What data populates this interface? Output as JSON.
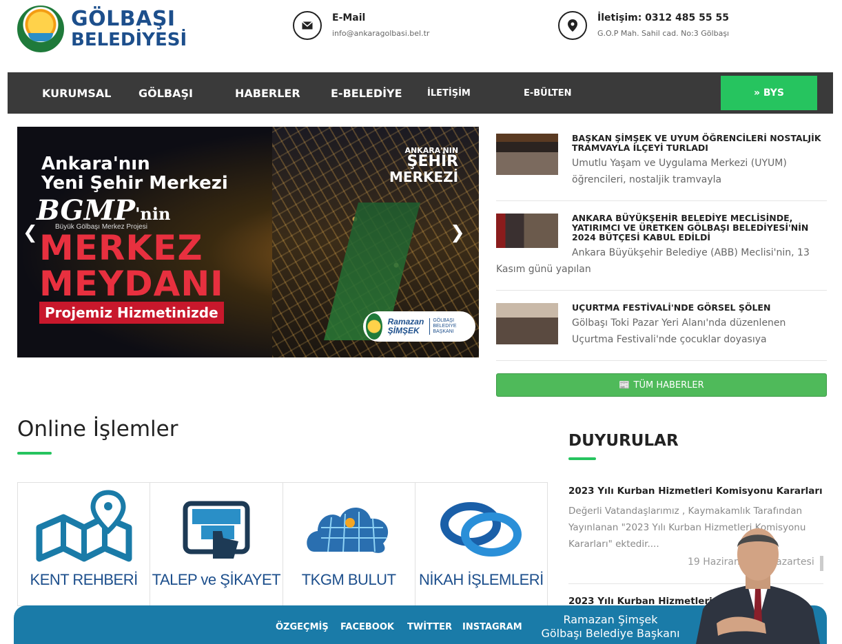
{
  "header": {
    "logo": {
      "line1": "GÖLBAŞI",
      "line2": "BELEDİYESİ",
      "seal_text": "GÖLBAŞI BELEDİYESİ 1965"
    },
    "email": {
      "icon": "envelope-icon",
      "title": "E-Mail",
      "value": "info@ankaragolbasi.bel.tr"
    },
    "phone": {
      "icon": "map-pin-icon",
      "title": "İletişim: 0312 485 55 55",
      "value": "G.O.P Mah. Sahil cad. No:3 Gölbaşı"
    }
  },
  "nav": {
    "items": [
      "KURUMSAL",
      "GÖLBAŞI",
      "HABERLER",
      "E-BELEDİYE",
      "İLETİŞİM",
      "E-BÜLTEN"
    ],
    "bys": "» BYS"
  },
  "slider": {
    "line1": "Ankara'nın",
    "line2": "Yeni Şehir Merkezi",
    "bgmp": "BGMP",
    "bgmp_suffix": "'nin",
    "bgmp_sub": "Büyük Gölbaşı Merkez Projesi",
    "merkez": "MERKEZ",
    "meydani": "MEYDANI",
    "projemiz": "Projemiz Hizmetinizde",
    "sehir_1": "ANKARA'NIN",
    "sehir_2": "ŞEHİR",
    "sehir_3": "MERKEZİ",
    "badge_name_1": "Ramazan",
    "badge_name_2": "ŞİMŞEK",
    "badge_title": "GÖLBAŞI BELEDİYE BAŞKANI"
  },
  "news": [
    {
      "title": "BAŞKAN ŞİMŞEK VE UYUM ÖĞRENCİLERİ NOSTALJİK TRAMVAYLA İLÇEYİ TURLADI",
      "desc_1": "Umutlu Yaşam ve Uygulama Merkezi (UYUM)",
      "desc_2": "öğrencileri, nostaljik tramvayla"
    },
    {
      "title": "ANKARA BÜYÜKŞEHİR BELEDİYE MECLİSİNDE, YATIRIMCI VE ÜRETKEN GÖLBAŞI BELEDİYESİ'NİN 2024 BÜTÇESİ KABUL EDİLDİ",
      "desc_1": "Ankara Büyükşehir Belediye (ABB) Meclisi'nin, 13",
      "desc_2": "Kasım günü yapılan"
    },
    {
      "title": "UÇURTMA FESTİVALİ'NDE GÖRSEL ŞÖLEN",
      "desc_1": "Gölbaşı Toki Pazar Yeri Alanı'nda düzenlenen",
      "desc_2": "Uçurtma Festivali'nde çocuklar doyasıya"
    }
  ],
  "all_news": "TÜM HABERLER",
  "online": {
    "title": "Online İşlemler",
    "tiles": [
      "KENT REHBERİ",
      "TALEP ve ŞİKAYET",
      "TKGM BULUT",
      "NİKAH İŞLEMLERİ"
    ]
  },
  "duyurular": {
    "title": "DUYURULAR",
    "item1_title": "2023 Yılı Kurban Hizmetleri Komisyonu Kararları",
    "item1_text": "Değerli Vatandaşlarımız , Kaymakamlık Tarafından Yayınlanan \"2023 Yılı Kurban Hizmetleri Komisyonu Kararları\" ektedir....",
    "item1_date": "19 Haziran 2023 Pazartesi",
    "item2_title": "2023 Yılı Kurban Hizmetleri Ko"
  },
  "footer": {
    "links": [
      "ÖZGEÇMİŞ",
      "FACEBOOK",
      "TWİTTER",
      "INSTAGRAM"
    ],
    "name": "Ramazan Şimşek",
    "role": "Gölbaşı Belediye Başkanı"
  },
  "colors": {
    "accent_green": "#26c45f",
    "brand_blue": "#1d4f8c",
    "nav_bg": "#3a3a3a",
    "footer_blue": "#1a7ba8",
    "news_button": "#4fba5a"
  }
}
